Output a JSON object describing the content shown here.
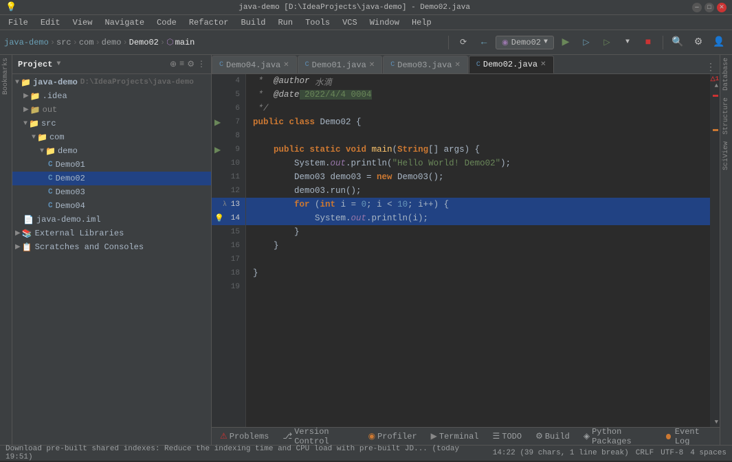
{
  "titlebar": {
    "title": "java-demo [D:\\IdeaProjects\\java-demo] - Demo02.java",
    "appname": "IntelliJ IDEA"
  },
  "menu": {
    "items": [
      "File",
      "Edit",
      "View",
      "Navigate",
      "Code",
      "Refactor",
      "Build",
      "Run",
      "Tools",
      "VCS",
      "Window",
      "Help"
    ]
  },
  "toolbar": {
    "breadcrumb": [
      "java-demo",
      "src",
      "com",
      "demo",
      "Demo02",
      "main"
    ],
    "runconfig": "Demo02"
  },
  "tabs": [
    {
      "label": "Demo04.java",
      "active": false
    },
    {
      "label": "Demo01.java",
      "active": false
    },
    {
      "label": "Demo03.java",
      "active": false
    },
    {
      "label": "Demo02.java",
      "active": true
    }
  ],
  "project": {
    "title": "Project",
    "tree": [
      {
        "label": "java-demo",
        "path": "D:\\IdeaProjects\\java-demo",
        "type": "root",
        "indent": 0,
        "expanded": true
      },
      {
        "label": ".idea",
        "type": "folder",
        "indent": 1,
        "expanded": false
      },
      {
        "label": "out",
        "type": "folder-yellow",
        "indent": 1,
        "expanded": false
      },
      {
        "label": "src",
        "type": "folder",
        "indent": 1,
        "expanded": true
      },
      {
        "label": "com",
        "type": "folder",
        "indent": 2,
        "expanded": true
      },
      {
        "label": "demo",
        "type": "folder",
        "indent": 3,
        "expanded": true
      },
      {
        "label": "Demo01",
        "type": "java",
        "indent": 4
      },
      {
        "label": "Demo02",
        "type": "java",
        "indent": 4,
        "selected": true
      },
      {
        "label": "Demo03",
        "type": "java",
        "indent": 4
      },
      {
        "label": "Demo04",
        "type": "java",
        "indent": 4
      },
      {
        "label": "java-demo.iml",
        "type": "iml",
        "indent": 1
      },
      {
        "label": "External Libraries",
        "type": "library",
        "indent": 0,
        "expanded": false
      },
      {
        "label": "Scratches and Consoles",
        "type": "scratch",
        "indent": 0,
        "expanded": false
      }
    ]
  },
  "code": {
    "lines": [
      {
        "num": 4,
        "content": " *  @author 水滴",
        "type": "comment_author"
      },
      {
        "num": 5,
        "content": " *  @date 2022/4/4 0004",
        "type": "comment_date"
      },
      {
        "num": 6,
        "content": " */",
        "type": "comment"
      },
      {
        "num": 7,
        "content": "public class Demo02 {",
        "type": "class",
        "hasRunArrow": true
      },
      {
        "num": 8,
        "content": "",
        "type": "empty"
      },
      {
        "num": 9,
        "content": "    public static void main(String[] args) {",
        "type": "method",
        "hasRunArrow": true,
        "hasLambda": true
      },
      {
        "num": 10,
        "content": "        System.out.println(\"Hello World! Demo02\");",
        "type": "sysout"
      },
      {
        "num": 11,
        "content": "        Demo03 demo03 = new Demo03();",
        "type": "code"
      },
      {
        "num": 12,
        "content": "        demo03.run();",
        "type": "code"
      },
      {
        "num": 13,
        "content": "        for (int i = 0; i < 10; i++) {",
        "type": "for_highlighted",
        "highlighted": true,
        "hasLambda": true
      },
      {
        "num": 14,
        "content": "            System.out.println(i);",
        "type": "sysout_highlighted",
        "highlighted": true,
        "hasBulb": true
      },
      {
        "num": 15,
        "content": "        }",
        "type": "code_highlighted",
        "highlighted": false
      },
      {
        "num": 16,
        "content": "    }",
        "type": "code"
      },
      {
        "num": 17,
        "content": "",
        "type": "empty"
      },
      {
        "num": 18,
        "content": "}",
        "type": "code"
      },
      {
        "num": 19,
        "content": "",
        "type": "empty"
      }
    ]
  },
  "bottom_tabs": [
    {
      "label": "Problems",
      "icon": "⚠",
      "active": false
    },
    {
      "label": "Version Control",
      "icon": "⎇",
      "active": false
    },
    {
      "label": "Profiler",
      "icon": "◉",
      "active": false
    },
    {
      "label": "Terminal",
      "icon": "▶",
      "active": false
    },
    {
      "label": "TODO",
      "icon": "☰",
      "active": false
    },
    {
      "label": "Build",
      "icon": "⚙",
      "active": false
    },
    {
      "label": "Python Packages",
      "icon": "◈",
      "active": false
    }
  ],
  "statusbar": {
    "left": "Download pre-built shared indexes: Reduce the indexing time and CPU load with pre-built JD... (today 19:51)",
    "position": "14:22 (39 chars, 1 line break)",
    "line_ending": "CRLF",
    "encoding": "UTF-8",
    "indent": "4 spaces",
    "event_log": "Event Log",
    "event_count": "1"
  },
  "right_panel": {
    "items": [
      "Database",
      "Structure",
      "SciView"
    ]
  },
  "left_panel": {
    "items": [
      "Bookmarks"
    ]
  },
  "icons": {
    "run": "▶",
    "debug": "🐞",
    "arrow_right": "▶",
    "arrow_down": "▼",
    "folder": "📁",
    "close": "✕",
    "settings": "⚙",
    "search": "🔍",
    "more": "⋮",
    "chevron_right": "›",
    "chevron_down": "⌄",
    "bulb": "💡",
    "error": "△"
  },
  "colors": {
    "bg_dark": "#2b2b2b",
    "bg_panel": "#3c3f41",
    "highlight_blue": "#214283",
    "accent_green": "#6a8759",
    "accent_orange": "#cc7832",
    "accent_blue": "#5f90b8",
    "selected_blue": "#214283"
  }
}
